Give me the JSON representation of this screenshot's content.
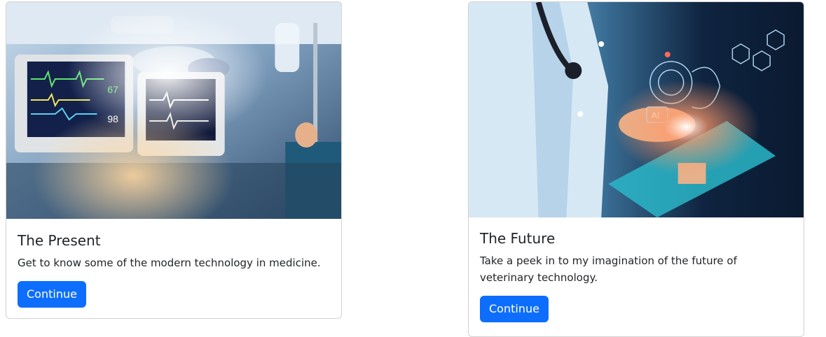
{
  "cards": [
    {
      "title": "The Present",
      "text": "Get to know some of the modern technology in medicine.",
      "button_label": "Continue",
      "image": "hospital-icu-monitors-photo"
    },
    {
      "title": "The Future",
      "text": "Take a peek in to my imagination of the future of veterinary technology.",
      "button_label": "Continue",
      "image": "doctor-ai-tablet-photo"
    }
  ],
  "colors": {
    "primary": "#0d6efd",
    "card_border": "#d9d9d9"
  }
}
